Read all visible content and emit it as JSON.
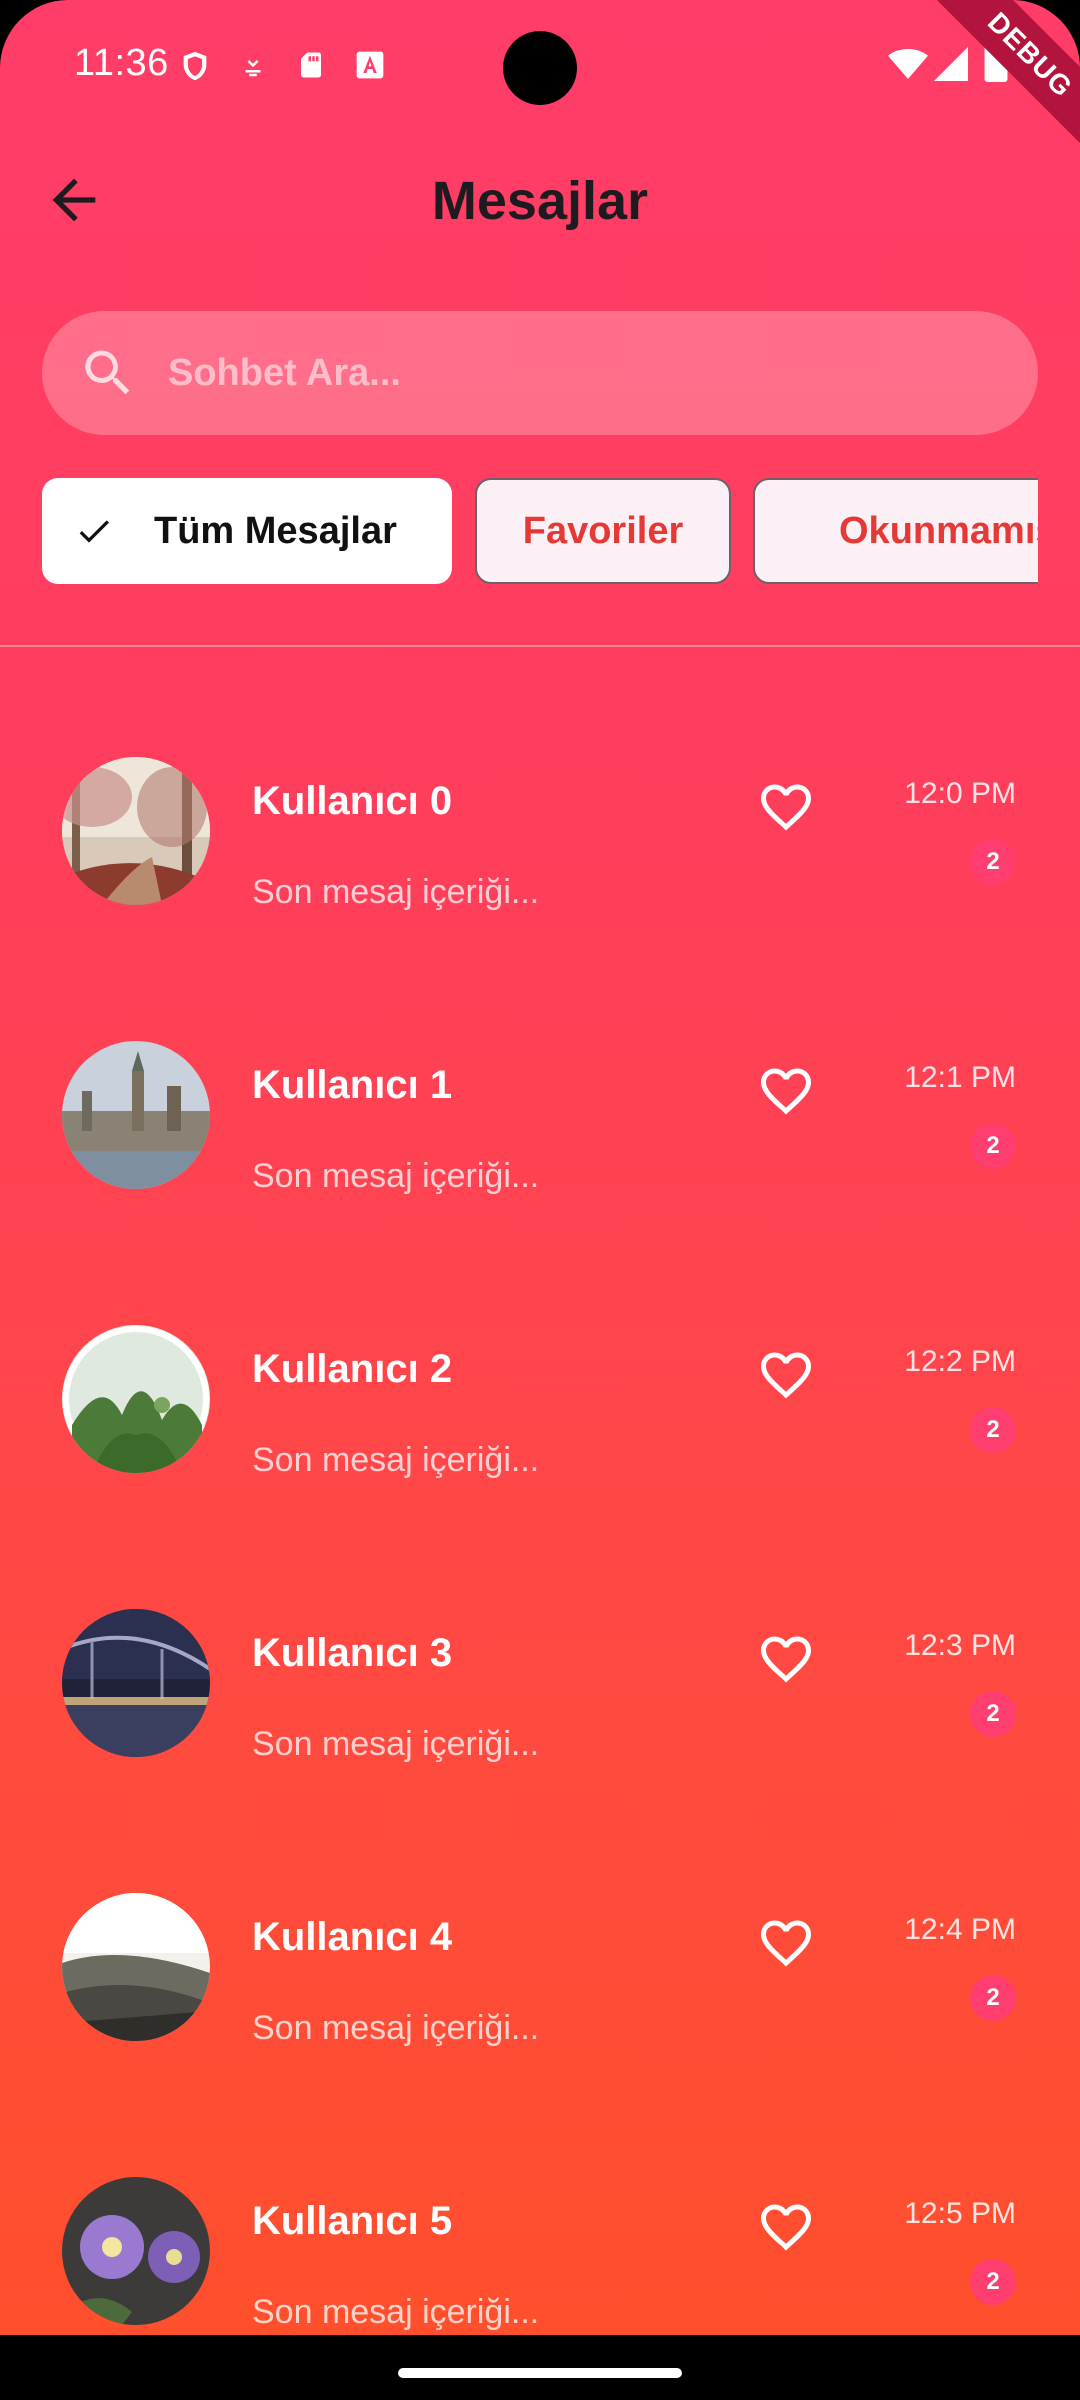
{
  "status_bar": {
    "time": "11:36",
    "icons": [
      "shield-icon",
      "download-icon",
      "sd-card-icon",
      "font-a-icon"
    ],
    "right_icons": [
      "wifi-icon",
      "signal-icon",
      "battery-icon"
    ],
    "debug_label": "DEBUG"
  },
  "app_bar": {
    "title": "Mesajlar",
    "back_icon": "arrow-back-icon"
  },
  "search": {
    "placeholder": "Sohbet Ara...",
    "value": ""
  },
  "filters": {
    "all": "Tüm Mesajlar",
    "favorites": "Favoriler",
    "unread": "Okunmamış",
    "selected": "all"
  },
  "chats": [
    {
      "name": "Kullanıcı 0",
      "preview": "Son mesaj içeriği...",
      "time": "12:0 PM",
      "unread": "2",
      "avatar": "forest-path"
    },
    {
      "name": "Kullanıcı 1",
      "preview": "Son mesaj içeriği...",
      "time": "12:1 PM",
      "unread": "2",
      "avatar": "city-skyline"
    },
    {
      "name": "Kullanıcı 2",
      "preview": "Son mesaj içeriği...",
      "time": "12:2 PM",
      "unread": "2",
      "avatar": "terrarium-plants"
    },
    {
      "name": "Kullanıcı 3",
      "preview": "Son mesaj içeriği...",
      "time": "12:3 PM",
      "unread": "2",
      "avatar": "night-bridge"
    },
    {
      "name": "Kullanıcı 4",
      "preview": "Son mesaj içeriği...",
      "time": "12:4 PM",
      "unread": "2",
      "avatar": "misty-valley"
    },
    {
      "name": "Kullanıcı 5",
      "preview": "Son mesaj içeriği...",
      "time": "12:5 PM",
      "unread": "2",
      "avatar": "purple-flowers"
    }
  ],
  "colors": {
    "gradient_top": "#ff3d68",
    "gradient_bottom": "#ff4f2c",
    "chip_text": "#e53935",
    "badge": "#ff3d6f"
  }
}
